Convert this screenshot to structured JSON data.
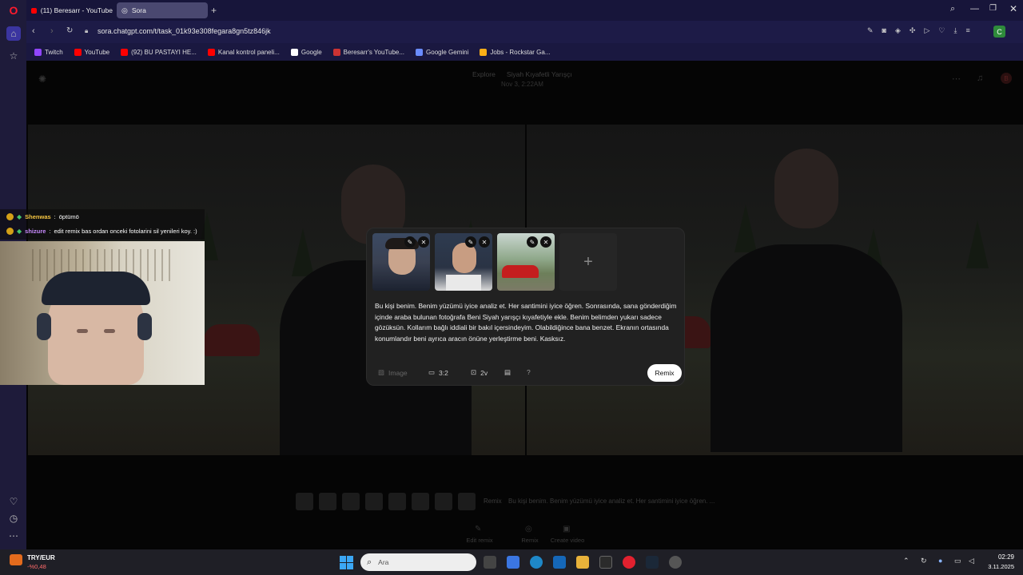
{
  "browser": {
    "tabs": [
      {
        "label": "(11) Beresarr - YouTube",
        "active": false
      },
      {
        "label": "Sora",
        "active": true
      }
    ],
    "url": "sora.chatgpt.com/t/task_01k93e308fegara8gn5tz846jk",
    "bookmarks": [
      {
        "label": "Twitch",
        "color": "#9146ff"
      },
      {
        "label": "YouTube",
        "color": "#ff0000"
      },
      {
        "label": "(92) BU PASTAYI HE...",
        "color": "#ff0000"
      },
      {
        "label": "Kanal kontrol paneli...",
        "color": "#ff0000"
      },
      {
        "label": "Google",
        "color": "#ffffff"
      },
      {
        "label": "Beresarr's YouTube...",
        "color": "#cc3333"
      },
      {
        "label": "Google Gemini",
        "color": "#6a8cff"
      },
      {
        "label": "Jobs - Rockstar Ga...",
        "color": "#fcaf17"
      }
    ]
  },
  "sora": {
    "nav": {
      "explore": "Explore",
      "title": "Siyah Kıyafetli Yarışçı",
      "date": "Nov 3, 2:22AM",
      "avatar": "B"
    },
    "remix_panel": {
      "prompt": "Bu kişi benim. Benim yüzümü iyice analiz et. Her santimini iyice öğren. Sonrasında, sana gönderdiğim içinde araba bulunan fotoğrafa Beni Siyah yarışçı kıyafetiyle ekle. Benim belimden yukarı sadece gözüksün. Kollarım bağlı iddiali bir bakıl içersindeyim. Olabildiğince bana benzet. Ekranın ortasında konumlandır beni ayrıca aracın önüne yerleştirme beni. Kasksız.",
      "image_label": "Image",
      "ratio": "3:2",
      "variations": "2v",
      "help": "?",
      "remix_button": "Remix",
      "add_symbol": "+"
    },
    "bottom": {
      "remix_label": "Remix",
      "remix_prompt_preview": "Bu kişi benim. Benim yüzümü iyice analiz et. Her santimini iyice öğren. ...",
      "actions": [
        "Edit remix",
        "Remix",
        "Create video"
      ]
    }
  },
  "stream_chat": [
    {
      "user": "Shenwas",
      "message": "öptümö",
      "color": "#f5c542"
    },
    {
      "user": "shizure",
      "message": "edit remix bas ordan onceki fotolarini sil yenileri koy. :)",
      "color": "#c98bff"
    }
  ],
  "taskbar": {
    "currency": {
      "pair": "TRY/EUR",
      "change": "-%0,48"
    },
    "search_placeholder": "Ara",
    "time": "02:29",
    "date": "3.11.2025"
  }
}
